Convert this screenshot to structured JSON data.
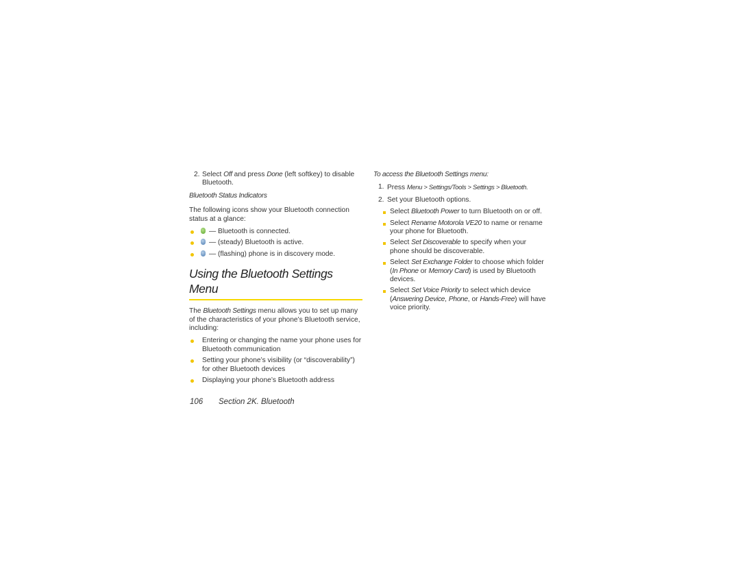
{
  "left": {
    "step2": {
      "num": "2.",
      "pre": "Select ",
      "off": "Off",
      "mid": " and press ",
      "done": "Done",
      "post": " (left softkey) to disable Bluetooth."
    },
    "status_heading": "Bluetooth Status Indicators",
    "status_intro": "The following icons show your Bluetooth connection status at a glance:",
    "indicators": [
      {
        "icon": "bluetooth-connected-icon",
        "color": "#5fa832",
        "text": "— Bluetooth is connected."
      },
      {
        "icon": "bluetooth-active-icon",
        "color": "#4f7fb4",
        "text": "— (steady) Bluetooth is active."
      },
      {
        "icon": "bluetooth-discovery-icon",
        "color": "#4f7fb4",
        "text": "— (flashing) phone is in discovery mode."
      }
    ],
    "section_title": "Using the Bluetooth Settings Menu",
    "intro": {
      "pre": "The ",
      "em": "Bluetooth Settings",
      "post": " menu allows you to set up many of the characteristics of your phone’s Bluetooth service, including:"
    },
    "features": [
      "Entering or changing the name your phone uses for Bluetooth communication",
      "Setting your phone’s visibility (or “discoverability”) for other Bluetooth devices",
      "Displaying your phone’s Bluetooth address"
    ]
  },
  "right": {
    "access_heading": "To access the Bluetooth Settings menu:",
    "step1": {
      "num": "1.",
      "pre": "Press ",
      "path": "Menu > Settings/Tools > Settings > Bluetooth."
    },
    "step2": {
      "num": "2.",
      "text": "Set your Bluetooth options."
    },
    "options": [
      {
        "pre": "Select ",
        "em": "Bluetooth Power",
        "post": " to turn Bluetooth on or off."
      },
      {
        "pre": "Select ",
        "em": "Rename Motorola VE20",
        "post": " to name or rename your phone for Bluetooth."
      },
      {
        "pre": "Select ",
        "em": "Set Discoverable",
        "post": " to specify when your phone should be discoverable."
      },
      {
        "pre": "Select ",
        "em": "Set Exchange Folder",
        "post": " to choose which folder (",
        "em2": "In Phone",
        "mid2": " or ",
        "em3": "Memory Card",
        "post2": ") is used by Bluetooth devices."
      },
      {
        "pre": "Select ",
        "em": "Set Voice Priority",
        "post": " to select which device (",
        "em2": "Answering Device",
        "mid2": ", ",
        "em3": "Phone",
        "mid3": ", or ",
        "em4": "Hands-Free",
        "post2": ") will have voice priority."
      }
    ]
  },
  "footer": {
    "page_number": "106",
    "section": "Section 2K. Bluetooth"
  },
  "colors": {
    "accent_yellow": "#f7d800",
    "bullet_yellow": "#f2c500",
    "text": "#333333"
  }
}
